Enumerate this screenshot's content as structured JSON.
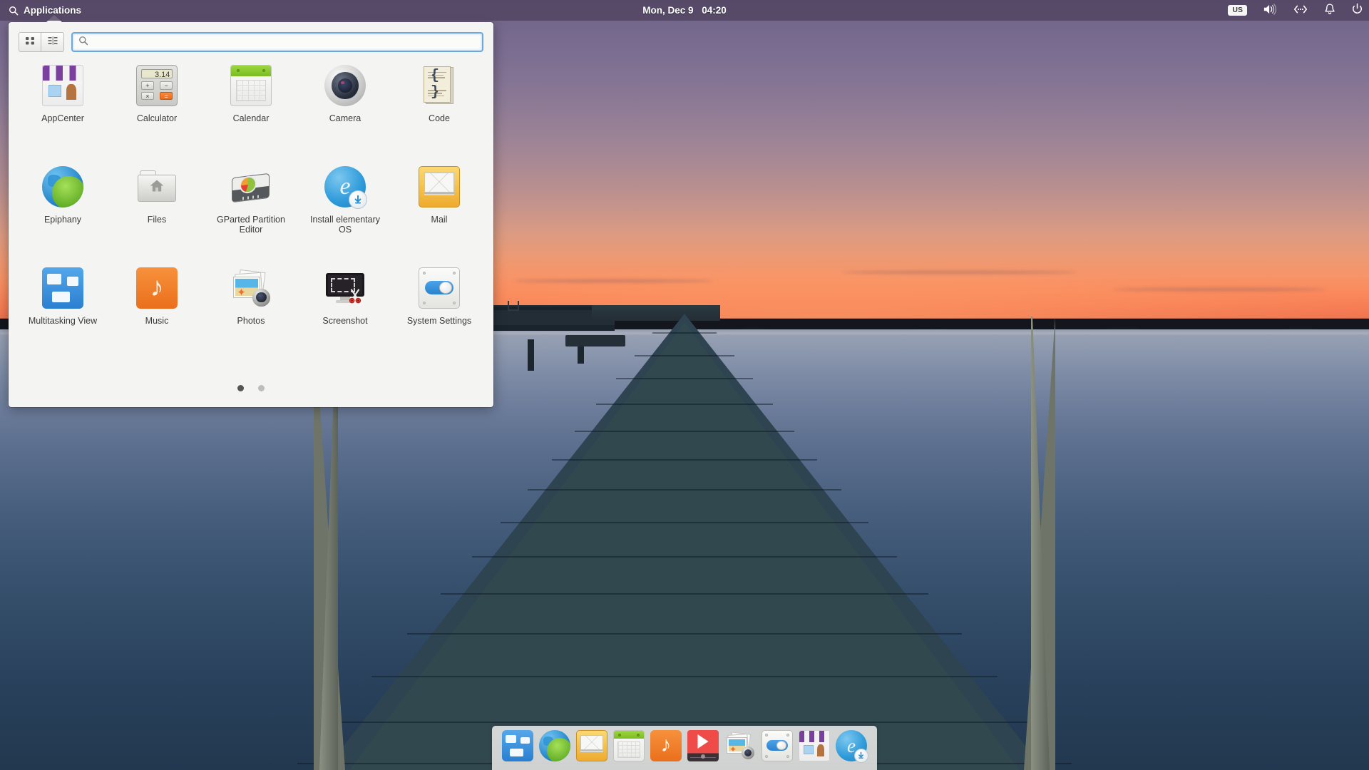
{
  "panel": {
    "applications_label": "Applications",
    "applications_icon": "search-icon",
    "clock": {
      "date": "Mon, Dec  9",
      "time": "04:20"
    },
    "tray": {
      "keyboard_layout": "us",
      "volume_icon": "speaker-icon",
      "network_icon": "network-icon",
      "notifications_icon": "bell-icon",
      "power_icon": "power-icon"
    },
    "background_color": "#504460"
  },
  "launcher": {
    "view_grid_icon": "grid-view-icon",
    "view_category_icon": "category-view-icon",
    "search": {
      "value": "",
      "placeholder": "",
      "icon": "search-icon"
    },
    "accent_color": "#6aa9e0",
    "apps": [
      {
        "label": "AppCenter",
        "icon": "appcenter-icon"
      },
      {
        "label": "Calculator",
        "icon": "calculator-icon",
        "display": "3.14",
        "keys": [
          "+",
          "−",
          "×",
          "="
        ]
      },
      {
        "label": "Calendar",
        "icon": "calendar-icon"
      },
      {
        "label": "Camera",
        "icon": "camera-icon"
      },
      {
        "label": "Code",
        "icon": "code-icon",
        "glyph": "{ }"
      },
      {
        "label": "Epiphany",
        "icon": "epiphany-icon"
      },
      {
        "label": "Files",
        "icon": "files-icon"
      },
      {
        "label": "GParted Partition Editor",
        "icon": "gparted-icon"
      },
      {
        "label": "Install elementary OS",
        "icon": "install-elementary-icon"
      },
      {
        "label": "Mail",
        "icon": "mail-icon"
      },
      {
        "label": "Multitasking View",
        "icon": "multitasking-view-icon"
      },
      {
        "label": "Music",
        "icon": "music-icon",
        "glyph": "♪"
      },
      {
        "label": "Photos",
        "icon": "photos-icon"
      },
      {
        "label": "Screenshot",
        "icon": "screenshot-icon"
      },
      {
        "label": "System Settings",
        "icon": "system-settings-icon"
      }
    ],
    "pages": {
      "count": 2,
      "active": 1
    }
  },
  "dock": {
    "items": [
      {
        "name": "Multitasking View",
        "icon": "multitasking-view-icon"
      },
      {
        "name": "Epiphany",
        "icon": "epiphany-icon"
      },
      {
        "name": "Mail",
        "icon": "mail-icon"
      },
      {
        "name": "Calendar",
        "icon": "calendar-icon"
      },
      {
        "name": "Music",
        "icon": "music-icon"
      },
      {
        "name": "Videos",
        "icon": "videos-icon"
      },
      {
        "name": "Photos",
        "icon": "photos-icon"
      },
      {
        "name": "System Settings",
        "icon": "system-settings-icon"
      },
      {
        "name": "AppCenter",
        "icon": "appcenter-icon"
      },
      {
        "name": "Install elementary OS",
        "icon": "install-elementary-icon"
      }
    ]
  },
  "wallpaper": {
    "description": "Wooden pier at sunset over calm water",
    "sky_top_color": "#6d6288",
    "sky_horizon_color": "#f87f55",
    "water_color": "#49607f",
    "deck_color": "#2e4451"
  }
}
